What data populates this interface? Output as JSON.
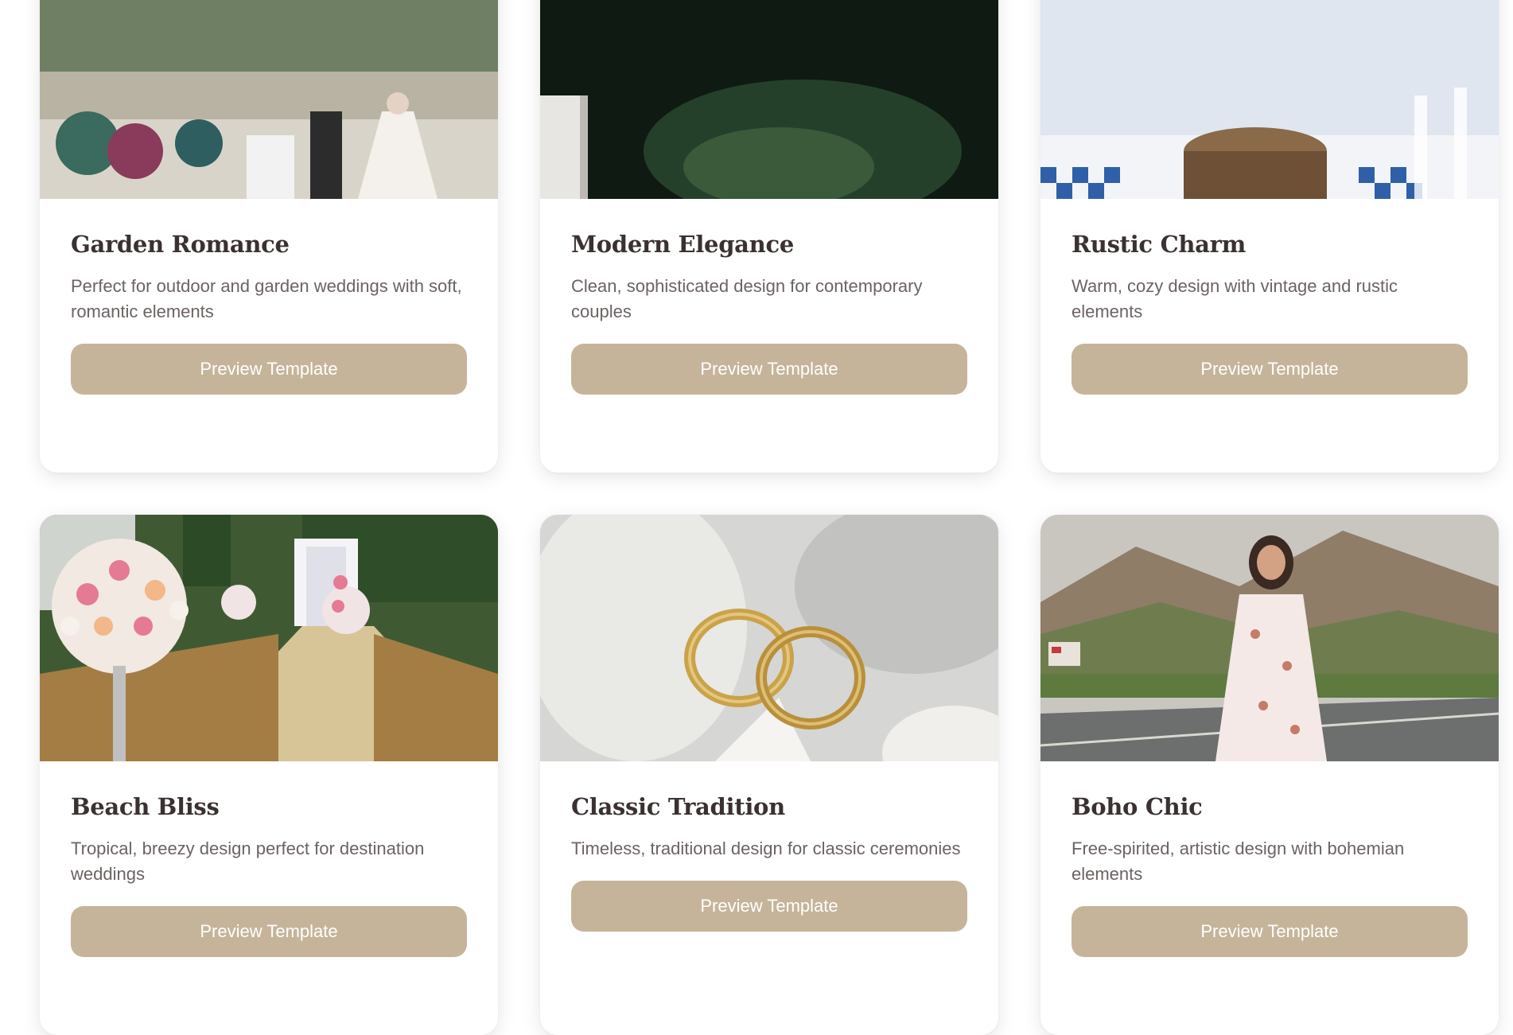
{
  "cards": [
    {
      "title": "Garden Romance",
      "description": "Perfect for outdoor and garden weddings with soft, romantic elements",
      "button": "Preview Template",
      "image": "garden-wedding-photo"
    },
    {
      "title": "Modern Elegance",
      "description": "Clean, sophisticated design for contemporary couples",
      "button": "Preview Template",
      "image": "modern-wedding-photo"
    },
    {
      "title": "Rustic Charm",
      "description": "Warm, cozy design with vintage and rustic elements",
      "button": "Preview Template",
      "image": "rustic-table-photo"
    },
    {
      "title": "Beach Bliss",
      "description": "Tropical, breezy design perfect for destination weddings",
      "button": "Preview Template",
      "image": "ceremony-aisle-flowers-photo"
    },
    {
      "title": "Classic Tradition",
      "description": "Timeless, traditional design for classic ceremonies",
      "button": "Preview Template",
      "image": "wedding-rings-photo"
    },
    {
      "title": "Boho Chic",
      "description": "Free-spirited, artistic design with bohemian elements",
      "button": "Preview Template",
      "image": "boho-woman-road-photo"
    }
  ],
  "colors": {
    "button": "#c6b49a",
    "title": "#3a3130",
    "description": "#6b6362"
  }
}
